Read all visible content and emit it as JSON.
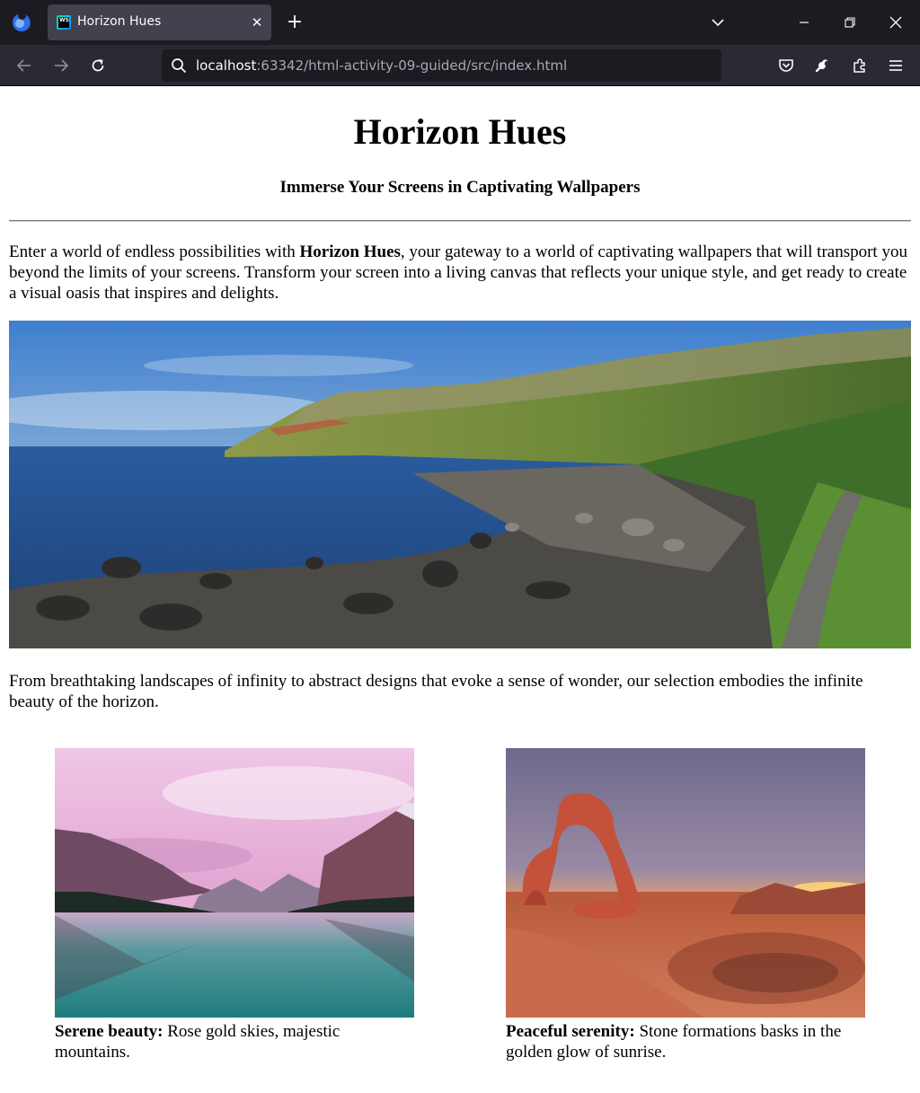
{
  "browser": {
    "tab_title": "Horizon Hues",
    "tab_icon": "webstorm-icon",
    "url_host": "localhost",
    "url_rest": ":63342/html-activity-09-guided/src/index.html",
    "close_glyph": "✕",
    "new_tab_glyph": "+"
  },
  "page": {
    "title": "Horizon Hues",
    "subtitle": "Immerse Your Screens in Captivating Wallpapers",
    "intro": {
      "before": "Enter a world of endless possibilities with ",
      "brand": "Horizon Hues",
      "after": ", your gateway to a world of captivating wallpapers that will transport you beyond the limits of your screens. Transform your screen into a living canvas that reflects your unique style, and get ready to create a visual oasis that inspires and delights."
    },
    "hero_image": "coastal-cliffs-landscape",
    "paragraph2": "From breathtaking landscapes of infinity to abstract designs that evoke a sense of wonder, our selection embodies the infinite beauty of the horizon.",
    "gallery": [
      {
        "image": "pink-sky-mountain-lake",
        "caption_bold": "Serene beauty:",
        "caption_text": " Rose gold skies, majestic mountains."
      },
      {
        "image": "desert-stone-arch-sunrise",
        "caption_bold": "Peaceful serenity:",
        "caption_text": " Stone formations basks in the golden glow of sunrise."
      }
    ]
  },
  "colors": {
    "tabbar_bg": "#1c1b22",
    "navbar_bg": "#2b2a33",
    "active_tab_bg": "#42414d",
    "page_bg": "#ffffff"
  }
}
